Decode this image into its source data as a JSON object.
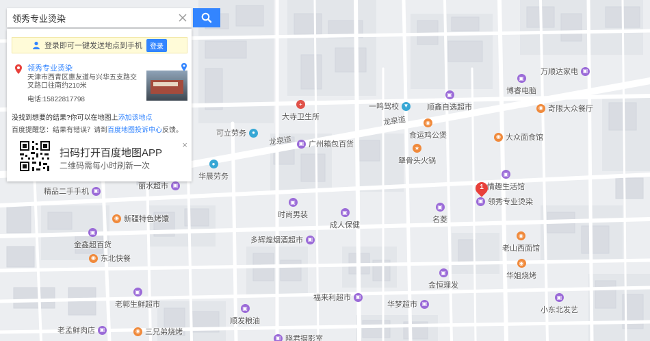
{
  "search": {
    "value": "领秀专业烫染",
    "clear_icon": "close-icon",
    "button_icon": "search-icon"
  },
  "panel": {
    "login_bar": {
      "text": "登录即可一键发送地点到手机",
      "button": "登录"
    },
    "result": {
      "marker": "1",
      "name": "领秀专业烫染",
      "address": "天津市西青区惠友道与兴华五支路交叉路口往南约210米",
      "phone": "电话:15822817798"
    },
    "not_found": {
      "prefix": "没找到想要的结果?你可以在地图上",
      "link": "添加该地点"
    },
    "hint": {
      "prefix": "百度提醒您：结果有错误？请到",
      "link": "百度地图投诉中心",
      "suffix": "反馈。"
    },
    "qr": {
      "title": "扫码打开百度地图APP",
      "subtitle": "二维码需每小时刷新一次",
      "close": "×"
    }
  },
  "map": {
    "roads": [
      "龙泉道",
      "龙泉道"
    ],
    "selected_marker": "1",
    "pois": [
      {
        "name": "万顺达家电",
        "color": "#9b6bd8"
      },
      {
        "name": "博睿电脑",
        "color": "#9b6bd8"
      },
      {
        "name": "奇限大众餐厅",
        "color": "#f08a3c"
      },
      {
        "name": "大寺卫生所",
        "color": "#e0524a"
      },
      {
        "name": "一鸣驾校",
        "color": "#37a7d5"
      },
      {
        "name": "顺鑫自选超市",
        "color": "#9b6bd8"
      },
      {
        "name": "食运鸡公煲",
        "color": "#f08a3c"
      },
      {
        "name": "大众面食馆",
        "color": "#f08a3c"
      },
      {
        "name": "可立劳务",
        "color": "#37a7d5"
      },
      {
        "name": "广州箱包百货",
        "color": "#9b6bd8"
      },
      {
        "name": "犟骨头火锅",
        "color": "#f08a3c"
      },
      {
        "name": "华晨劳务",
        "color": "#37a7d5"
      },
      {
        "name": "情趣生活馆",
        "color": "#9b6bd8"
      },
      {
        "name": "领秀专业烫染",
        "color": "#9b6bd8"
      },
      {
        "name": "精品二手手机",
        "color": "#9b6bd8"
      },
      {
        "name": "新疆特色烤馕",
        "color": "#f08a3c"
      },
      {
        "name": "时尚男装",
        "color": "#9b6bd8"
      },
      {
        "name": "成人保健",
        "color": "#9b6bd8"
      },
      {
        "name": "名菱",
        "color": "#9b6bd8"
      },
      {
        "name": "金鑫超百货",
        "color": "#9b6bd8"
      },
      {
        "name": "多辉煌烟酒超市",
        "color": "#9b6bd8"
      },
      {
        "name": "老山西面馆",
        "color": "#f08a3c"
      },
      {
        "name": "东北快餐",
        "color": "#f08a3c"
      },
      {
        "name": "华姐烧烤",
        "color": "#f08a3c"
      },
      {
        "name": "金恒理发",
        "color": "#9b6bd8"
      },
      {
        "name": "老郭生鲜超市",
        "color": "#9b6bd8"
      },
      {
        "name": "福来利超市",
        "color": "#9b6bd8"
      },
      {
        "name": "华梦超市",
        "color": "#9b6bd8"
      },
      {
        "name": "小东北发艺",
        "color": "#9b6bd8"
      },
      {
        "name": "顺发粮油",
        "color": "#9b6bd8"
      },
      {
        "name": "老孟鲜肉店",
        "color": "#9b6bd8"
      },
      {
        "name": "三兄弟烧烤",
        "color": "#f08a3c"
      },
      {
        "name": "晓君摄影室",
        "color": "#9b6bd8"
      },
      {
        "name": "丽水超市",
        "color": "#9b6bd8"
      }
    ]
  }
}
